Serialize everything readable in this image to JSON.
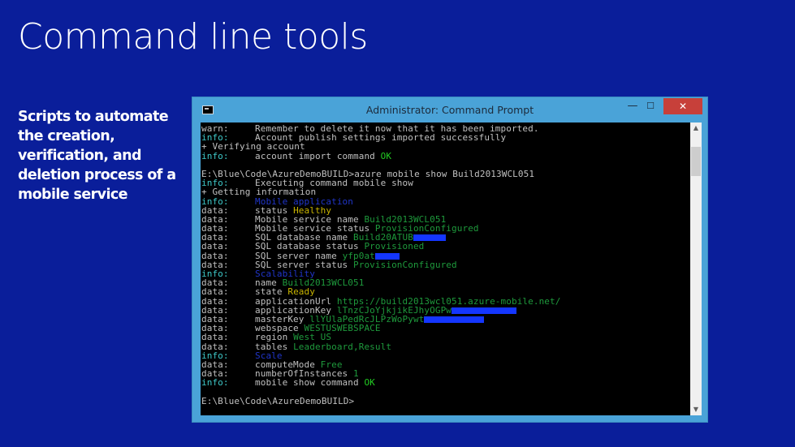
{
  "slide": {
    "title": "Command line tools",
    "bullet": "Scripts to automate the creation, verification, and deletion process of a mobile service"
  },
  "window": {
    "title": "Administrator: Command Prompt",
    "minimize_glyph": "—",
    "maximize_glyph": "☐",
    "close_glyph": "✕"
  },
  "console": {
    "lines": [
      [
        {
          "t": "warn:",
          "c": "gray",
          "w": 1
        },
        {
          "t": "Remember to delete it now that it has been imported.",
          "c": "gray"
        }
      ],
      [
        {
          "t": "info:",
          "c": "cyan",
          "w": 1
        },
        {
          "t": "Account publish settings imported successfully",
          "c": "gray"
        }
      ],
      [
        {
          "t": "+ Verifying account",
          "c": "gray"
        }
      ],
      [
        {
          "t": "info:",
          "c": "cyan",
          "w": 1
        },
        {
          "t": "account import command ",
          "c": "gray"
        },
        {
          "t": "OK",
          "c": "green"
        }
      ],
      [
        {
          "t": "",
          "c": "gray"
        }
      ],
      [
        {
          "t": "E:\\Blue\\Code\\AzureDemoBUILD>azure mobile show Build2013WCL051",
          "c": "gray"
        }
      ],
      [
        {
          "t": "info:",
          "c": "cyan",
          "w": 1
        },
        {
          "t": "Executing command mobile show",
          "c": "gray"
        }
      ],
      [
        {
          "t": "+ Getting information",
          "c": "gray"
        }
      ],
      [
        {
          "t": "info:",
          "c": "cyan",
          "w": 1
        },
        {
          "t": "Mobile application",
          "c": "blue"
        }
      ],
      [
        {
          "t": "data:",
          "c": "gray",
          "w": 1
        },
        {
          "t": "status ",
          "c": "gray"
        },
        {
          "t": "Healthy",
          "c": "yellow"
        }
      ],
      [
        {
          "t": "data:",
          "c": "gray",
          "w": 1
        },
        {
          "t": "Mobile service name ",
          "c": "gray"
        },
        {
          "t": "Build2013WCL051",
          "c": "dkgreen"
        }
      ],
      [
        {
          "t": "data:",
          "c": "gray",
          "w": 1
        },
        {
          "t": "Mobile service status ",
          "c": "gray"
        },
        {
          "t": "ProvisionConfigured",
          "c": "dkgreen"
        }
      ],
      [
        {
          "t": "data:",
          "c": "gray",
          "w": 1
        },
        {
          "t": "SQL database name ",
          "c": "gray"
        },
        {
          "t": "Build20ATUB",
          "c": "dkgreen"
        },
        {
          "r": 40
        }
      ],
      [
        {
          "t": "data:",
          "c": "gray",
          "w": 1
        },
        {
          "t": "SQL database status ",
          "c": "gray"
        },
        {
          "t": "Provisioned",
          "c": "dkgreen"
        }
      ],
      [
        {
          "t": "data:",
          "c": "gray",
          "w": 1
        },
        {
          "t": "SQL server name ",
          "c": "gray"
        },
        {
          "t": "yfp0at",
          "c": "dkgreen"
        },
        {
          "r": 30
        }
      ],
      [
        {
          "t": "data:",
          "c": "gray",
          "w": 1
        },
        {
          "t": "SQL server status ",
          "c": "gray"
        },
        {
          "t": "ProvisionConfigured",
          "c": "dkgreen"
        }
      ],
      [
        {
          "t": "info:",
          "c": "cyan",
          "w": 1
        },
        {
          "t": "Scalability",
          "c": "blue"
        }
      ],
      [
        {
          "t": "data:",
          "c": "gray",
          "w": 1
        },
        {
          "t": "name ",
          "c": "gray"
        },
        {
          "t": "Build2013WCL051",
          "c": "dkgreen"
        }
      ],
      [
        {
          "t": "data:",
          "c": "gray",
          "w": 1
        },
        {
          "t": "state ",
          "c": "gray"
        },
        {
          "t": "Ready",
          "c": "yellow"
        }
      ],
      [
        {
          "t": "data:",
          "c": "gray",
          "w": 1
        },
        {
          "t": "applicationUrl ",
          "c": "gray"
        },
        {
          "t": "https://build2013wcl051.azure-mobile.net/",
          "c": "dkgreen"
        }
      ],
      [
        {
          "t": "data:",
          "c": "gray",
          "w": 1
        },
        {
          "t": "applicationKey ",
          "c": "gray"
        },
        {
          "t": "lTnzCJoYjkjikEJhyOGPw",
          "c": "dkgreen"
        },
        {
          "r": 80
        }
      ],
      [
        {
          "t": "data:",
          "c": "gray",
          "w": 1
        },
        {
          "t": "masterKey ",
          "c": "gray"
        },
        {
          "t": "llYUlaPedRcJLPzWoPywt",
          "c": "dkgreen"
        },
        {
          "r": 74
        }
      ],
      [
        {
          "t": "data:",
          "c": "gray",
          "w": 1
        },
        {
          "t": "webspace ",
          "c": "gray"
        },
        {
          "t": "WESTUSWEBSPACE",
          "c": "dkgreen"
        }
      ],
      [
        {
          "t": "data:",
          "c": "gray",
          "w": 1
        },
        {
          "t": "region ",
          "c": "gray"
        },
        {
          "t": "West US",
          "c": "dkgreen"
        }
      ],
      [
        {
          "t": "data:",
          "c": "gray",
          "w": 1
        },
        {
          "t": "tables ",
          "c": "gray"
        },
        {
          "t": "Leaderboard,Result",
          "c": "dkgreen"
        }
      ],
      [
        {
          "t": "info:",
          "c": "cyan",
          "w": 1
        },
        {
          "t": "Scale",
          "c": "blue"
        }
      ],
      [
        {
          "t": "data:",
          "c": "gray",
          "w": 1
        },
        {
          "t": "computeMode ",
          "c": "gray"
        },
        {
          "t": "Free",
          "c": "dkgreen"
        }
      ],
      [
        {
          "t": "data:",
          "c": "gray",
          "w": 1
        },
        {
          "t": "numberOfInstances ",
          "c": "gray"
        },
        {
          "t": "1",
          "c": "dkgreen"
        }
      ],
      [
        {
          "t": "info:",
          "c": "cyan",
          "w": 1
        },
        {
          "t": "mobile show command ",
          "c": "gray"
        },
        {
          "t": "OK",
          "c": "green"
        }
      ],
      [
        {
          "t": "",
          "c": "gray"
        }
      ],
      [
        {
          "t": "E:\\Blue\\Code\\AzureDemoBUILD>",
          "c": "gray"
        }
      ]
    ]
  },
  "scrollbar": {
    "up_glyph": "▲",
    "down_glyph": "▼"
  },
  "colors": {
    "slide_bg": "#0a1e9a",
    "window_frame": "#4aa3d8",
    "close_button": "#c7403a",
    "console_bg": "#000000",
    "redaction": "#1436ff"
  }
}
